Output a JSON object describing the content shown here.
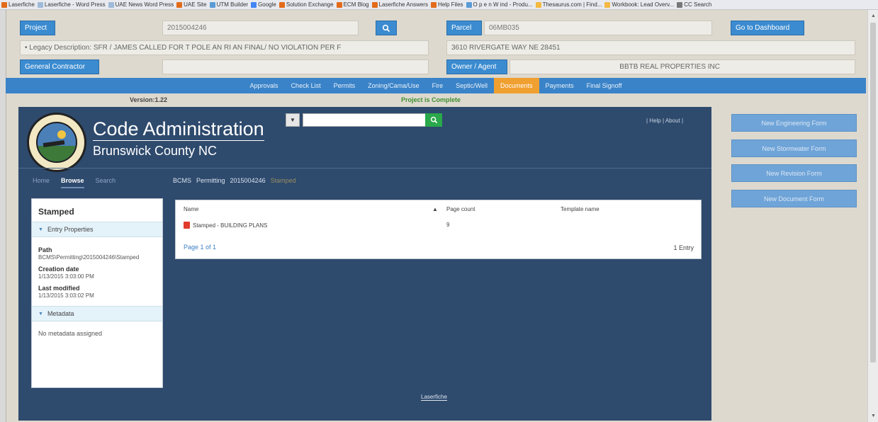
{
  "bookmarks": [
    {
      "label": "Laserfiche",
      "color": "#e26b1b"
    },
    {
      "label": "Laserfiche - Word Press",
      "color": "#9fbad8"
    },
    {
      "label": "UAE News Word Press",
      "color": "#9fbad8"
    },
    {
      "label": "UAE Site",
      "color": "#e26b1b"
    },
    {
      "label": "UTM Builder",
      "color": "#5b9bd5"
    },
    {
      "label": "Google",
      "color": "#4285f4"
    },
    {
      "label": "Solution Exchange",
      "color": "#e26b1b"
    },
    {
      "label": "ECM Blog",
      "color": "#e26b1b"
    },
    {
      "label": "Laserfiche Answers",
      "color": "#e26b1b"
    },
    {
      "label": "Help Files",
      "color": "#e26b1b"
    },
    {
      "label": "O p e n W ind - Produ...",
      "color": "#5b9bd5"
    },
    {
      "label": "Thesaurus.com | Find...",
      "color": "#f4b942"
    },
    {
      "label": "Workbook: Lead Overv...",
      "color": "#f4b942"
    },
    {
      "label": "CC Search",
      "color": "#777777"
    }
  ],
  "header": {
    "project_label": "Project",
    "project_value": "2015004246",
    "parcel_label": "Parcel",
    "parcel_value": "06MB035",
    "dashboard_label": "Go to Dashboard",
    "legacy_description": "• Legacy Description:  SFR / JAMES CALLED FOR T POLE AN RI AN FINAL/ NO VIOLATION PER F",
    "address": "3610 RIVERGATE WAY NE 28451",
    "general_contractor_label": "General Contractor",
    "general_contractor_value": "",
    "owner_label": "Owner / Agent",
    "owner_value": "BBTB REAL PROPERTIES INC"
  },
  "nav": {
    "items": [
      "Approvals",
      "Check List",
      "Permits",
      "Zoning/Cama/Use",
      "Fire",
      "Septic/Well",
      "Documents",
      "Payments",
      "Final Signoff"
    ],
    "active": "Documents"
  },
  "status": {
    "version": "Version:1.22",
    "project_status": "Project is Complete"
  },
  "laserfiche": {
    "title": "Code Administration",
    "subtitle": "Brunswick County NC",
    "links": "| Help | About |",
    "tabs": [
      "Home",
      "Browse",
      "Search"
    ],
    "active_tab": "Browse",
    "breadcrumbs": [
      "BCMS",
      "Permitting",
      "2015004246",
      "Stamped"
    ],
    "sidebar": {
      "title": "Stamped",
      "entry_properties_label": "Entry Properties",
      "path_label": "Path",
      "path_value": "BCMS\\Permitting\\2015004246\\Stamped",
      "creation_label": "Creation date",
      "creation_value": "1/13/2015 3:03:00 PM",
      "modified_label": "Last modified",
      "modified_value": "1/13/2015 3:03:02 PM",
      "metadata_label": "Metadata",
      "metadata_empty": "No metadata assigned"
    },
    "table": {
      "col_name": "Name",
      "col_page_count": "Page count",
      "col_template": "Template name",
      "rows": [
        {
          "name": "Stamped - BUILDING PLANS",
          "page_count": "9",
          "template": ""
        }
      ],
      "pager": "Page 1 of 1",
      "entry_count": "1 Entry"
    },
    "footer": "Laserfiche"
  },
  "right_buttons": [
    "New Engineering Form",
    "New Stormwater Form",
    "New Revision Form",
    "New Document Form"
  ]
}
